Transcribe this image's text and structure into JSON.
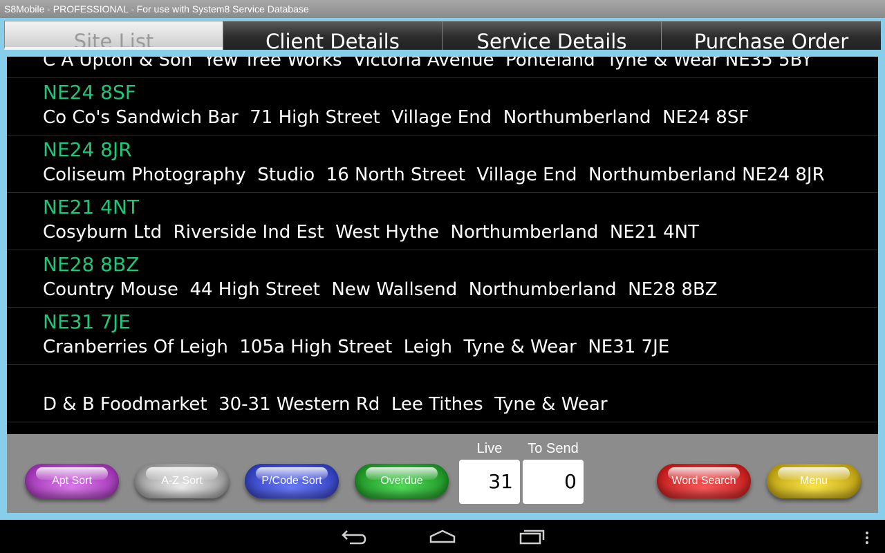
{
  "window": {
    "title": "S8Mobile - PROFESSIONAL - For use with System8 Service Database"
  },
  "tabs": [
    {
      "label": "Site List",
      "active": true
    },
    {
      "label": "Client Details",
      "active": false
    },
    {
      "label": "Service Details",
      "active": false
    },
    {
      "label": "Purchase Order",
      "active": false
    }
  ],
  "sites": [
    {
      "postcode": "",
      "address": "C A Upton & Son  Yew Tree Works  Victoria Avenue  Ponteland  Tyne & Wear NE35 5BY"
    },
    {
      "postcode": "NE24 8SF",
      "address": "Co Co's Sandwich Bar  71 High Street  Village End  Northumberland  NE24 8SF"
    },
    {
      "postcode": "NE24 8JR",
      "address": "Coliseum Photography  Studio  16 North Street  Village End  Northumberland NE24 8JR"
    },
    {
      "postcode": "NE21 4NT",
      "address": "Cosyburn Ltd  Riverside Ind Est  West Hythe  Northumberland  NE21 4NT"
    },
    {
      "postcode": "NE28 8BZ",
      "address": "Country Mouse  44 High Street  New Wallsend  Northumberland  NE28 8BZ"
    },
    {
      "postcode": "NE31 7JE",
      "address": "Cranberries Of Leigh  105a High Street  Leigh  Tyne & Wear  NE31 7JE"
    },
    {
      "postcode": "",
      "address": "D & B Foodmarket  30-31 Western Rd  Lee Tithes  Tyne & Wear"
    }
  ],
  "buttons": {
    "apt_sort": "Apt Sort",
    "az_sort": "A-Z Sort",
    "pcode_sort": "P/Code Sort",
    "overdue": "Overdue",
    "word_search": "Word Search",
    "menu": "Menu"
  },
  "counters": {
    "live_label": "Live",
    "live_value": "31",
    "tosend_label": "To Send",
    "tosend_value": "0"
  },
  "colors": {
    "postcode": "#1ec87a",
    "frame": "#87ceeb"
  },
  "navbar": {
    "icons": [
      "back-icon",
      "home-icon",
      "recent-apps-icon",
      "overflow-menu-icon"
    ]
  }
}
